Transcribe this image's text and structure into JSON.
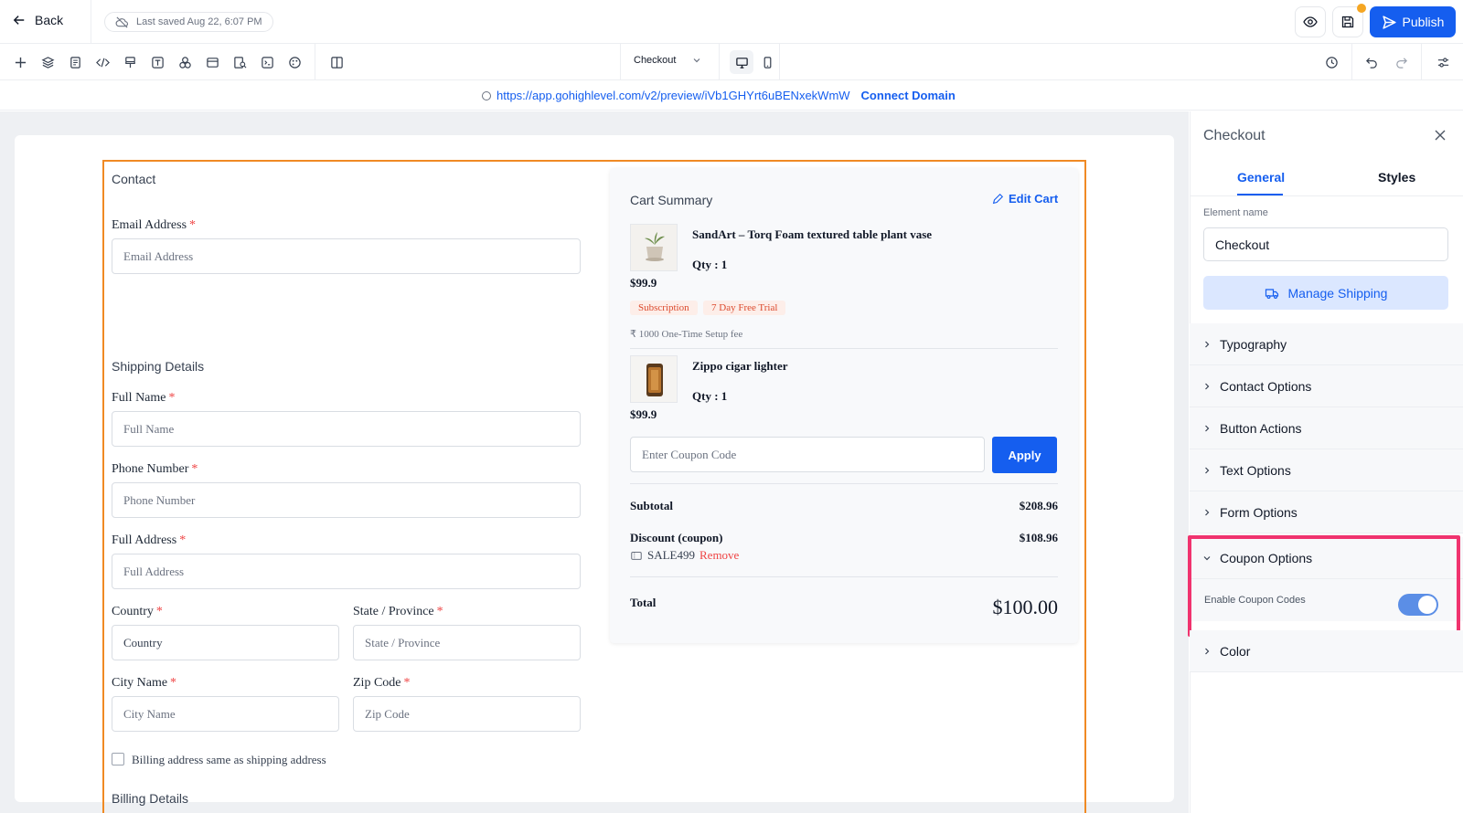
{
  "topbar": {
    "back_label": "Back",
    "last_saved": "Last saved Aug 22, 6:07 PM",
    "publish_label": "Publish"
  },
  "toolbar": {
    "page_select": "Checkout"
  },
  "urlbar": {
    "url": "https://app.gohighlevel.com/v2/preview/iVb1GHYrt6uBENxekWmW",
    "connect_domain": "Connect Domain"
  },
  "form": {
    "contact_title": "Contact",
    "email_label": "Email Address",
    "email_placeholder": "Email Address",
    "shipping_title": "Shipping Details",
    "fullname_label": "Full Name",
    "fullname_placeholder": "Full Name",
    "phone_label": "Phone Number",
    "phone_placeholder": "Phone Number",
    "address_label": "Full Address",
    "address_placeholder": "Full Address",
    "country_label": "Country",
    "country_placeholder": "Country",
    "state_label": "State / Province",
    "state_placeholder": "State / Province",
    "city_label": "City Name",
    "city_placeholder": "City Name",
    "zip_label": "Zip Code",
    "zip_placeholder": "Zip Code",
    "billing_same": "Billing address same as shipping address",
    "billing_title": "Billing Details",
    "required_mark": "*"
  },
  "cart": {
    "title": "Cart Summary",
    "edit_cart": "Edit Cart",
    "items": [
      {
        "name": "SandArt – Torq Foam textured table plant vase",
        "qty": "Qty : 1",
        "price": "$99.9",
        "tags": [
          "Subscription",
          "7 Day Free Trial"
        ],
        "setup_fee": "₹ 1000 One-Time Setup fee"
      },
      {
        "name": "Zippo cigar lighter",
        "qty": "Qty : 1",
        "price": "$99.9"
      }
    ],
    "coupon_placeholder": "Enter Coupon Code",
    "apply_label": "Apply",
    "subtotal_label": "Subtotal",
    "subtotal_value": "$208.96",
    "discount_label": "Discount (coupon)",
    "discount_value": "$108.96",
    "coupon_code": "SALE499",
    "remove_label": "Remove",
    "total_label": "Total",
    "total_value": "$100.00"
  },
  "panel": {
    "title": "Checkout",
    "tabs": [
      "General",
      "Styles"
    ],
    "element_name_label": "Element name",
    "element_name_value": "Checkout",
    "manage_shipping": "Manage Shipping",
    "sections": [
      "Typography",
      "Contact Options",
      "Button Actions",
      "Text Options",
      "Form Options",
      "Coupon Options",
      "Color"
    ],
    "enable_coupon_label": "Enable Coupon Codes",
    "enable_coupon_on": true
  },
  "colors": {
    "accent": "#155eef",
    "selection_frame": "#f08a24",
    "highlight": "#f0336e",
    "required": "#ef4444"
  }
}
